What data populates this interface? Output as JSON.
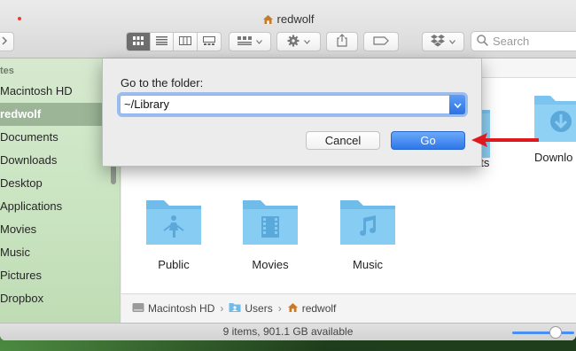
{
  "window": {
    "title": "redwolf"
  },
  "toolbar": {
    "search_placeholder": "Search"
  },
  "sidebar": {
    "section_header": "tes",
    "items": [
      {
        "label": "Macintosh HD",
        "selected": false
      },
      {
        "label": "redwolf",
        "selected": true
      },
      {
        "label": "Documents",
        "selected": false
      },
      {
        "label": "Downloads",
        "selected": false
      },
      {
        "label": "Desktop",
        "selected": false
      },
      {
        "label": "Applications",
        "selected": false
      },
      {
        "label": "Movies",
        "selected": false
      },
      {
        "label": "Music",
        "selected": false
      },
      {
        "label": "Pictures",
        "selected": false
      },
      {
        "label": "Dropbox",
        "selected": false
      }
    ]
  },
  "content": {
    "partial_labels": {
      "behind_sheet": "nts",
      "right_edge": "Downlo"
    },
    "folders": [
      {
        "label": "Public",
        "icon": "public-folder-icon"
      },
      {
        "label": "Movies",
        "icon": "movies-folder-icon"
      },
      {
        "label": "Music",
        "icon": "music-folder-icon"
      }
    ]
  },
  "pathbar": {
    "segments": [
      {
        "label": "Macintosh HD",
        "icon": "drive-icon"
      },
      {
        "label": "Users",
        "icon": "folder-icon"
      },
      {
        "label": "redwolf",
        "icon": "home-icon"
      }
    ]
  },
  "statusbar": {
    "text": "9 items, 901.1 GB available"
  },
  "go_to_folder_sheet": {
    "prompt": "Go to the folder:",
    "path_value": "~/Library",
    "cancel_label": "Cancel",
    "go_label": "Go"
  },
  "colors": {
    "accent": "#2f77ea",
    "sidebar_selection": "#9cb596",
    "folder_blue": "#7cc4f0",
    "annotation_arrow": "#e0191e"
  }
}
